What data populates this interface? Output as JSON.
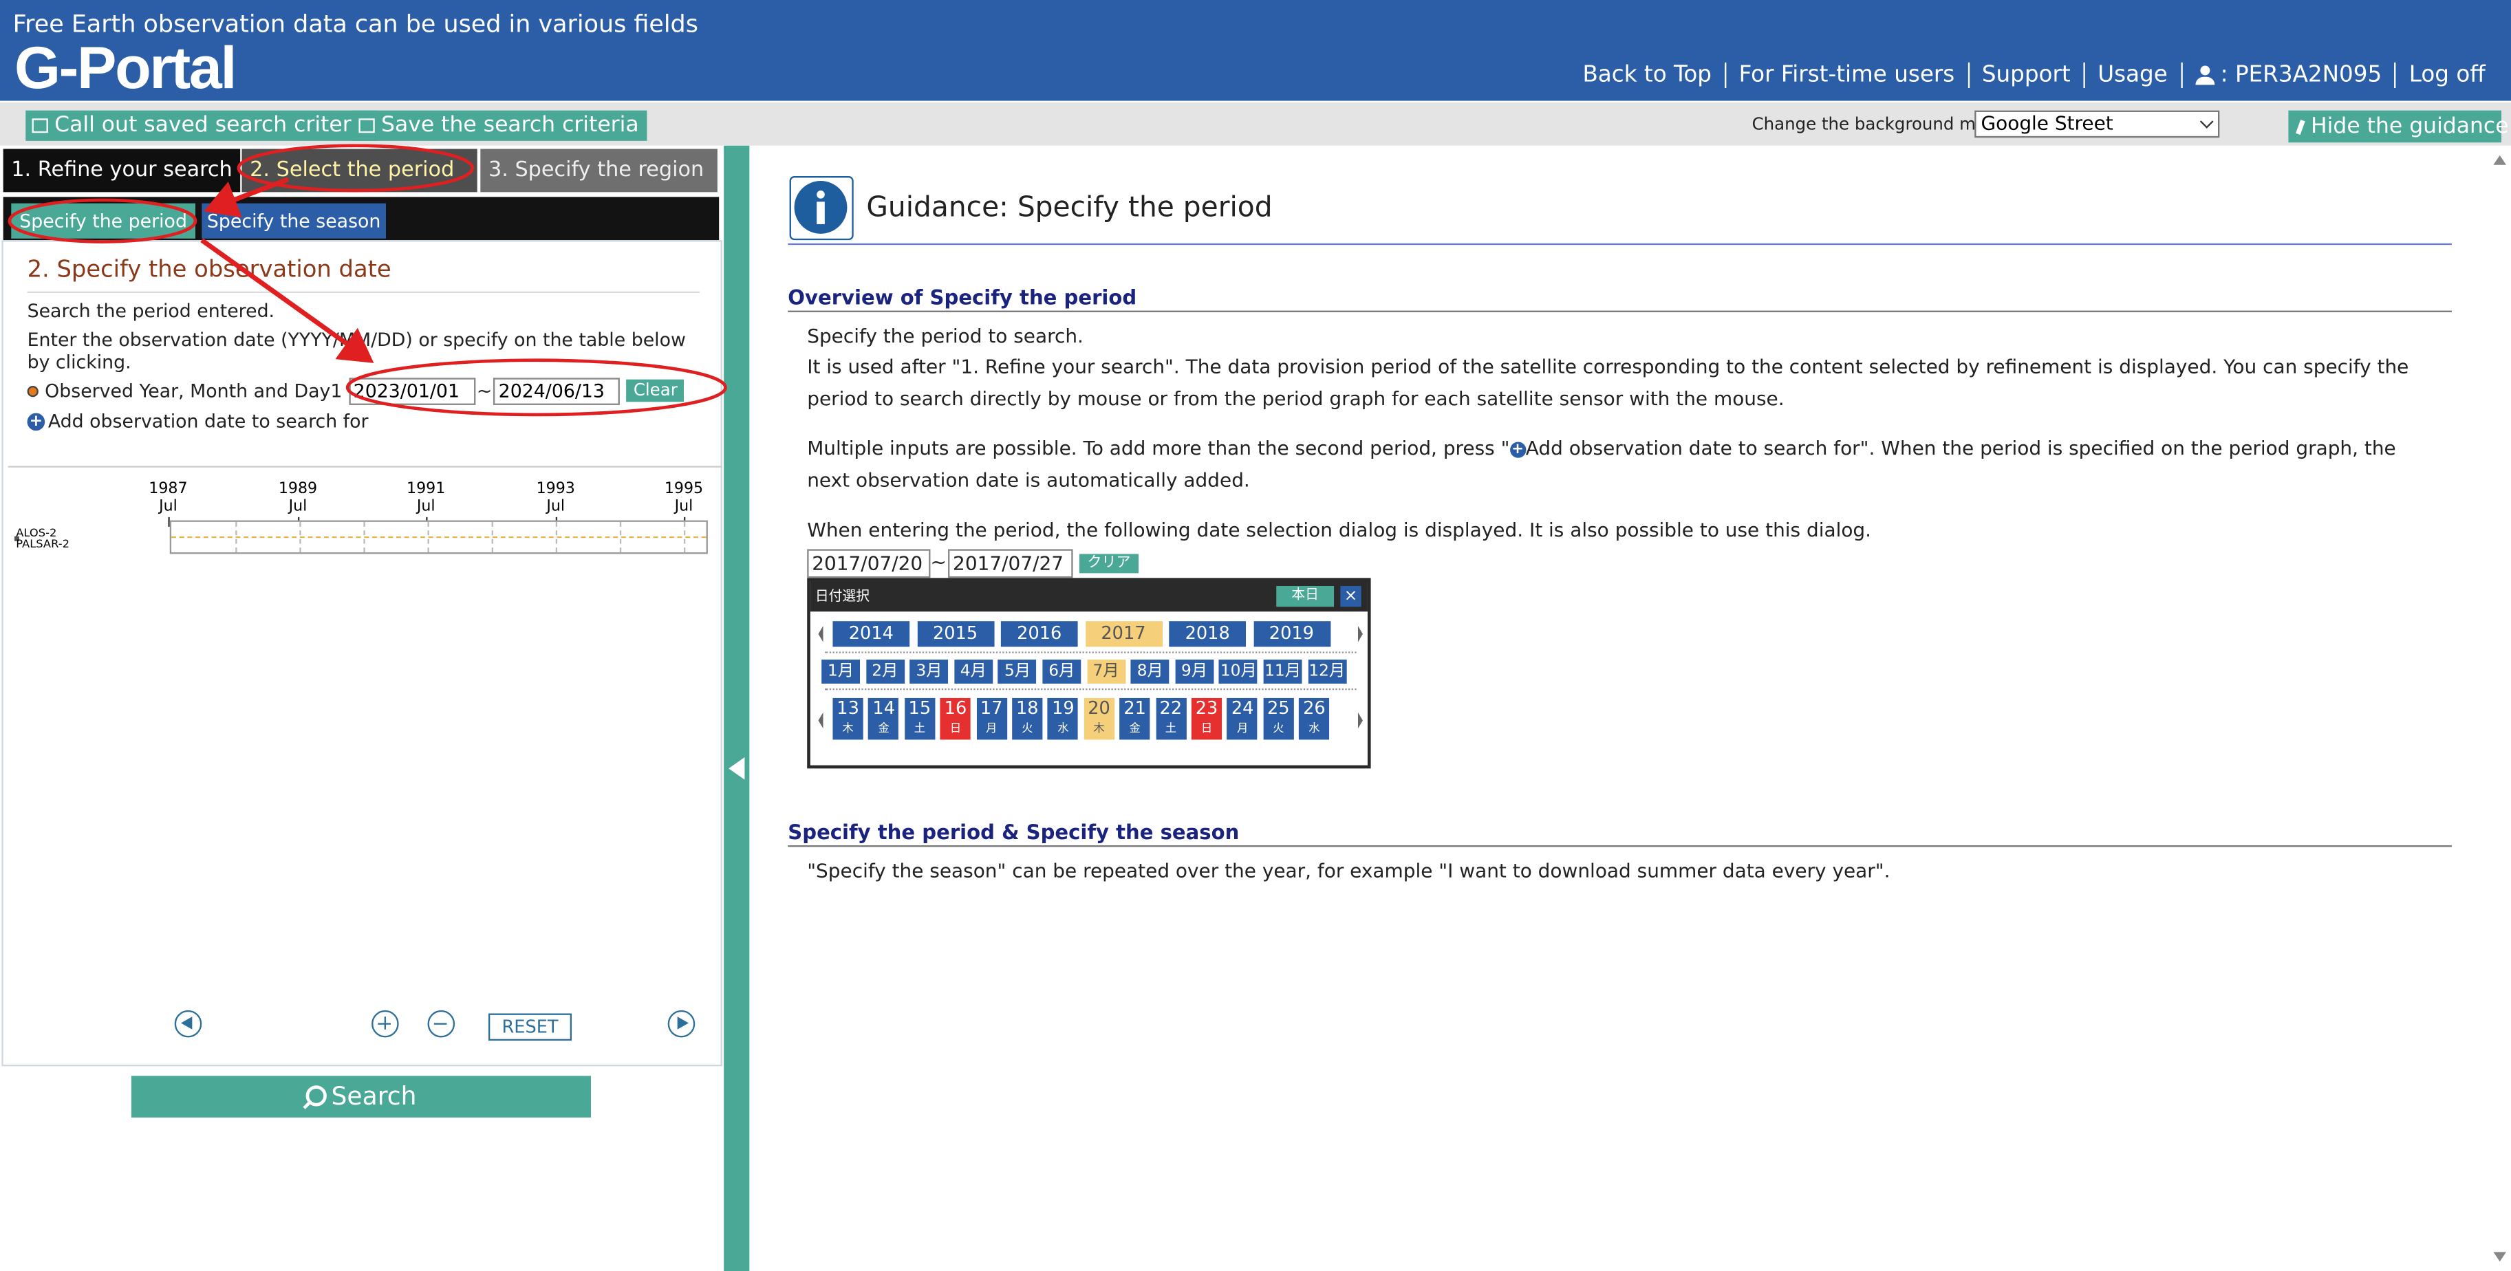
{
  "header": {
    "tagline": "Free Earth observation data can be used in various fields",
    "logo": "G-Portal",
    "nav": [
      {
        "label": "Back to Top"
      },
      {
        "label": "For First-time users"
      },
      {
        "label": "Support"
      },
      {
        "label": "Usage"
      }
    ],
    "user": ": PER3A2N095",
    "logoff": "Log off",
    "user_icon": "user-icon"
  },
  "toolbar": {
    "callout_label": "Call out saved search criteria",
    "save_label": "Save the search criteria",
    "bgmap_label": "Change the background map",
    "bgmap_value": "Google Street",
    "hide_guidance_label": "Hide the guidance"
  },
  "steps": {
    "step1": "1. Refine your search",
    "step2": "2. Select the period",
    "step3": "3. Specify the region"
  },
  "subtabs": {
    "period": "Specify the period",
    "season": "Specify the season"
  },
  "period_panel": {
    "title": "2. Specify the observation date",
    "line1": "Search the period entered.",
    "line2": "Enter the observation date (YYYY/MM/DD) or specify on the table below",
    "line3": "by clicking.",
    "observed_label": "Observed Year, Month and Day1",
    "start_date": "2023/01/01",
    "tilde": "~",
    "end_date": "2024/06/13",
    "clear_label": "Clear",
    "add_label": "Add observation date to search for",
    "years": [
      {
        "year": "1987",
        "month": "Jul"
      },
      {
        "year": "1989",
        "month": "Jul"
      },
      {
        "year": "1991",
        "month": "Jul"
      },
      {
        "year": "1993",
        "month": "Jul"
      },
      {
        "year": "1995",
        "month": "Jul"
      }
    ],
    "sensor_line1": "ALOS-2",
    "sensor_line2": "PALSAR-2",
    "reset_label": "RESET",
    "search_label": "Search"
  },
  "guidance": {
    "title": "Guidance: Specify the period",
    "section1_heading": "Overview of Specify the period",
    "p1": "Specify the period to search.",
    "p2": "It is used after \"1. Refine your search\". The data provision period of the satellite corresponding to the content selected by refinement is displayed. You can specify the period to search directly by mouse or from the period graph for each satellite sensor with the mouse.",
    "p3_before": "Multiple inputs are possible. To add more than the second period, press \"",
    "p3_after": "Add observation date to search for\". When the period is specified on the period graph, the next observation date is automatically added.",
    "p4": "When entering the period, the following date selection dialog is displayed. It is also possible to use this dialog.",
    "section2_heading": "Specify the period & Specify the season",
    "p5": "\"Specify the season\" can be repeated over the year, for example \"I want to download summer data every year\"."
  },
  "date_dialog": {
    "start": "2017/07/20",
    "tilde": "~",
    "end": "2017/07/27",
    "clear": "クリア",
    "title": "日付選択",
    "today": "本日",
    "close": "×",
    "years": [
      "2014",
      "2015",
      "2016",
      "2017",
      "2018",
      "2019"
    ],
    "selected_year": "2017",
    "months": [
      "1月",
      "2月",
      "3月",
      "4月",
      "5月",
      "6月",
      "7月",
      "8月",
      "9月",
      "10月",
      "11月",
      "12月"
    ],
    "selected_month": "7月",
    "days": [
      {
        "d": "13",
        "w": "木"
      },
      {
        "d": "14",
        "w": "金"
      },
      {
        "d": "15",
        "w": "土"
      },
      {
        "d": "16",
        "w": "日",
        "holiday": true
      },
      {
        "d": "17",
        "w": "月"
      },
      {
        "d": "18",
        "w": "火"
      },
      {
        "d": "19",
        "w": "水"
      },
      {
        "d": "20",
        "w": "木",
        "selected": true
      },
      {
        "d": "21",
        "w": "金"
      },
      {
        "d": "22",
        "w": "土"
      },
      {
        "d": "23",
        "w": "日",
        "holiday": true
      },
      {
        "d": "24",
        "w": "月"
      },
      {
        "d": "25",
        "w": "火"
      },
      {
        "d": "26",
        "w": "水"
      }
    ]
  },
  "colors": {
    "header_blue": "#2c5ea8",
    "teal": "#4aa897",
    "annotation_red": "#e02020",
    "selected_yellow": "#f5cf7a"
  }
}
